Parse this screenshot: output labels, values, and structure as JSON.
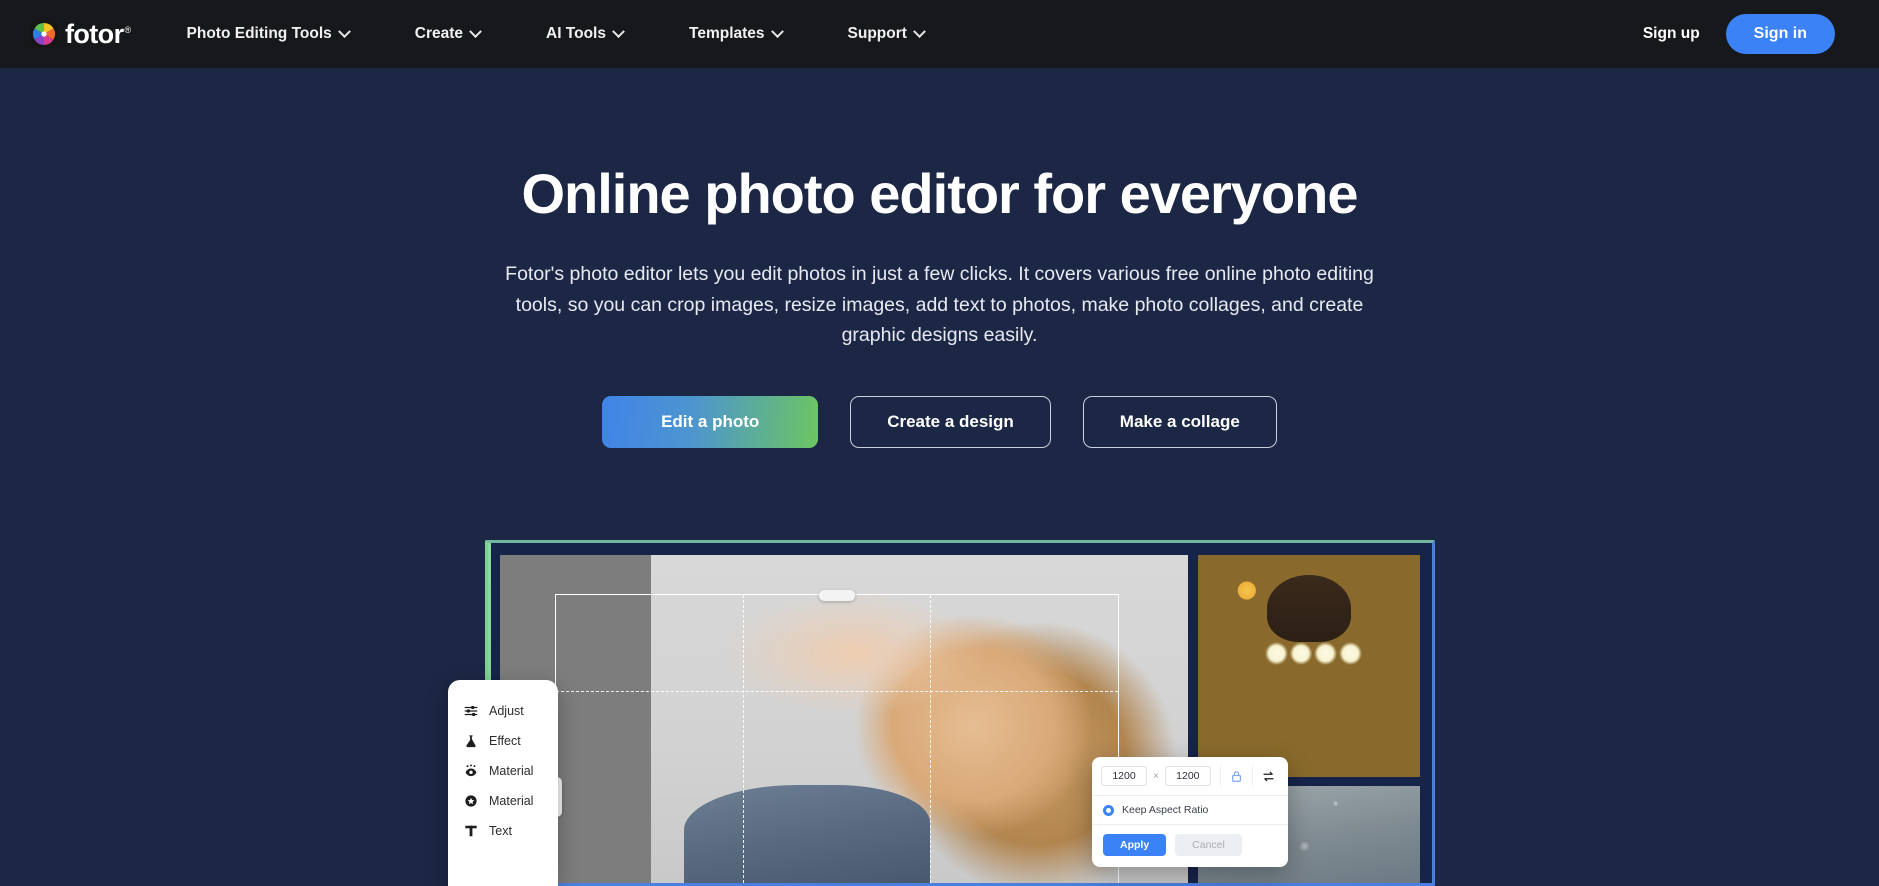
{
  "header": {
    "logo": {
      "text": "fotor",
      "registered": "®",
      "icon": "fotor-pinwheel-icon"
    },
    "nav": [
      {
        "label": "Photo Editing Tools",
        "icon": "chevron-down-icon"
      },
      {
        "label": "Create",
        "icon": "chevron-down-icon"
      },
      {
        "label": "AI Tools",
        "icon": "chevron-down-icon"
      },
      {
        "label": "Templates",
        "icon": "chevron-down-icon"
      },
      {
        "label": "Support",
        "icon": "chevron-down-icon"
      }
    ],
    "sign_up_label": "Sign up",
    "sign_in_label": "Sign in",
    "background": "#17181c",
    "accent": "#3b82f6"
  },
  "hero": {
    "title": "Online photo editor for everyone",
    "subtitle": "Fotor's photo editor lets you edit photos in just a few clicks. It covers various free online photo editing tools, so you can crop images, resize images, add text to photos, make photo collages, and create graphic designs easily.",
    "background": "#1c2746",
    "buttons": [
      {
        "label": "Edit a photo",
        "style": "primary-gradient"
      },
      {
        "label": "Create a design",
        "style": "outline"
      },
      {
        "label": "Make a collage",
        "style": "outline"
      }
    ]
  },
  "editor_mockup": {
    "frame_border_color": "#4a7fe0",
    "frame_accent_color": "#7fd18f",
    "tool_panel": {
      "items": [
        {
          "label": "Adjust",
          "icon": "sliders-icon"
        },
        {
          "label": "Effect",
          "icon": "flask-icon"
        },
        {
          "label": "Material",
          "icon": "eye-icon"
        },
        {
          "label": "Material",
          "icon": "badge-icon"
        },
        {
          "label": "Text",
          "icon": "text-t-icon"
        }
      ]
    },
    "resize_dialog": {
      "width_value": "1200",
      "height_value": "1200",
      "separator": "×",
      "lock_icon": "lock-icon",
      "swap_icon": "swap-arrows-icon",
      "aspect_ratio_label": "Keep Aspect Ratio",
      "apply_label": "Apply",
      "cancel_label": "Cancel",
      "accent": "#3b82f6"
    }
  }
}
